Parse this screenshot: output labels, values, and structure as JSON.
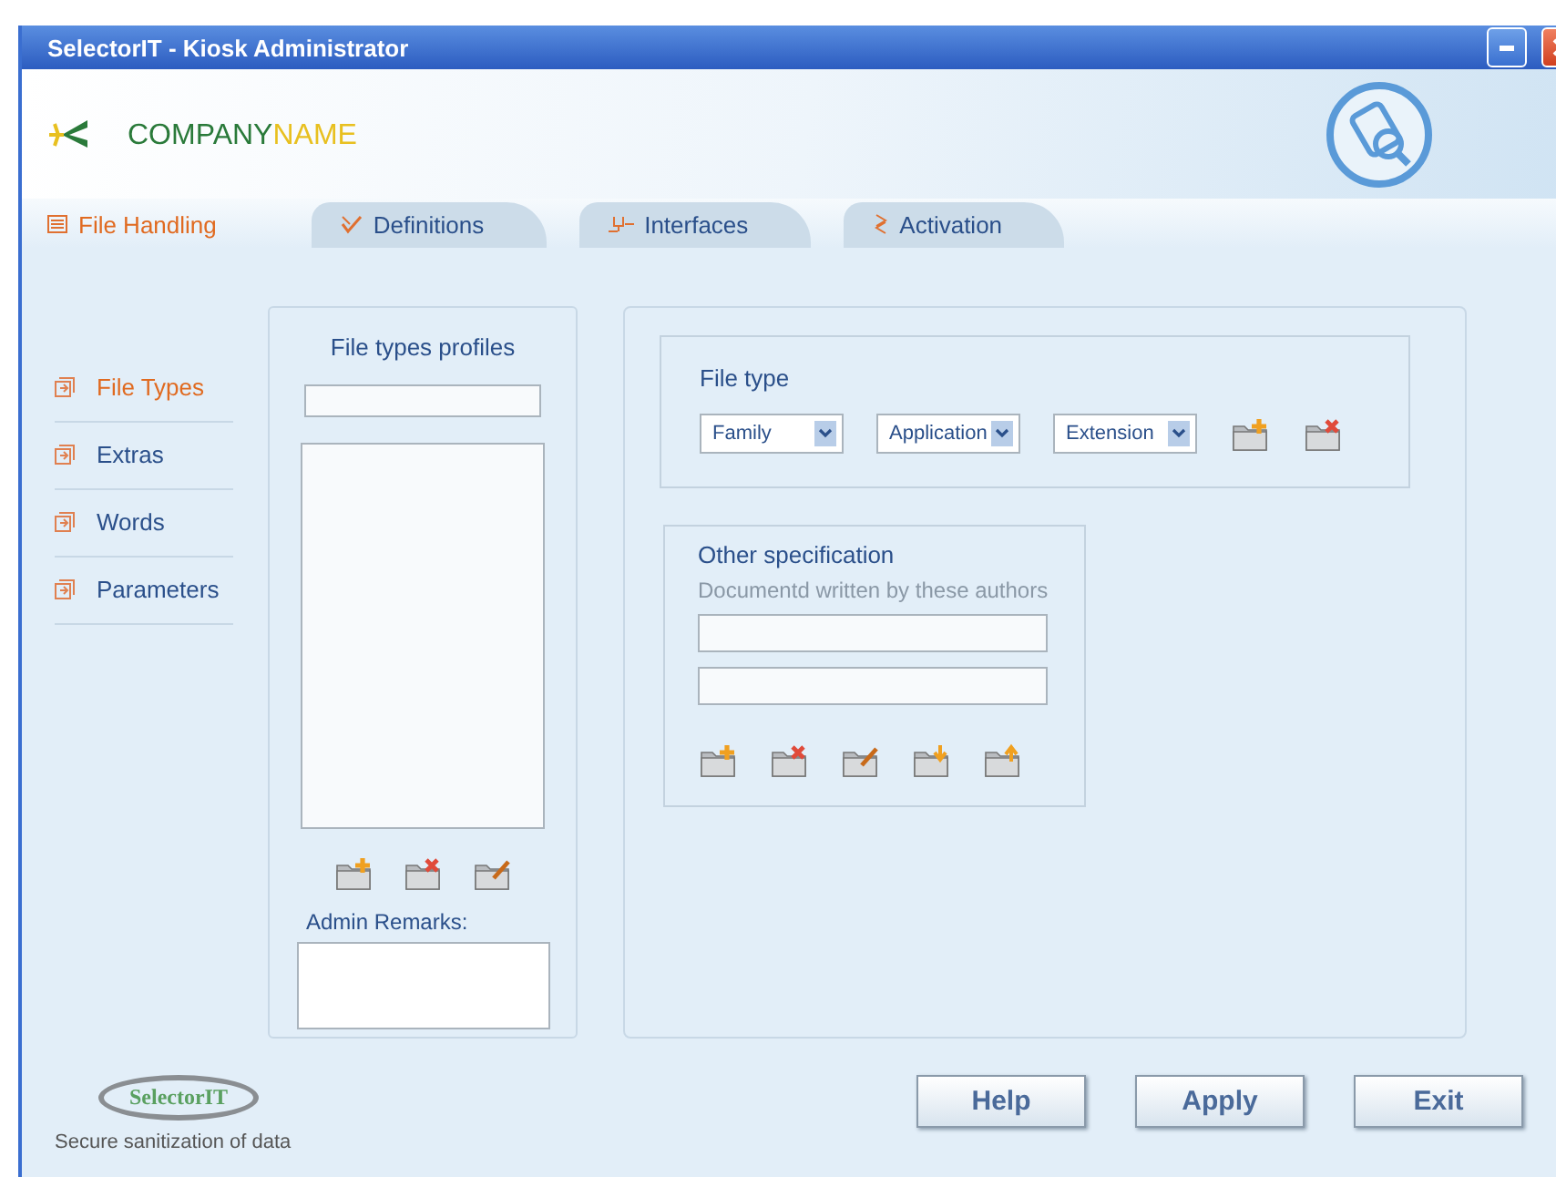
{
  "window": {
    "title": "SelectorIT - Kiosk Administrator"
  },
  "company": {
    "first": "COMPANY",
    "second": "NAME"
  },
  "tabs": [
    {
      "label": "File Handling",
      "kind": "list",
      "selected": true
    },
    {
      "label": "Definitions",
      "kind": "check",
      "selected": false
    },
    {
      "label": "Interfaces",
      "kind": "plug",
      "selected": false
    },
    {
      "label": "Activation",
      "kind": "arrows",
      "selected": false
    }
  ],
  "sidebar": {
    "items": [
      {
        "label": "File Types",
        "selected": true
      },
      {
        "label": "Extras",
        "selected": false
      },
      {
        "label": "Words",
        "selected": false
      },
      {
        "label": "Parameters",
        "selected": false
      }
    ]
  },
  "profiles": {
    "title": "File types profiles",
    "actions": [
      {
        "kind": "add"
      },
      {
        "kind": "delete"
      },
      {
        "kind": "edit"
      }
    ],
    "remarks_label": "Admin Remarks:"
  },
  "file_type": {
    "title": "File type",
    "selects": [
      {
        "value": "Family"
      },
      {
        "value": "Application"
      },
      {
        "value": "Extension"
      }
    ],
    "actions": [
      {
        "kind": "add"
      },
      {
        "kind": "delete"
      }
    ]
  },
  "other_specification": {
    "title": "Other specification",
    "hint": "Documentd written by these authors",
    "actions": [
      {
        "kind": "add"
      },
      {
        "kind": "delete"
      },
      {
        "kind": "edit"
      },
      {
        "kind": "down"
      },
      {
        "kind": "up"
      }
    ]
  },
  "footer": {
    "logo": "SelectorIT",
    "tagline": "Secure sanitization of data"
  },
  "buttons": [
    "Help",
    "Apply",
    "Exit"
  ]
}
